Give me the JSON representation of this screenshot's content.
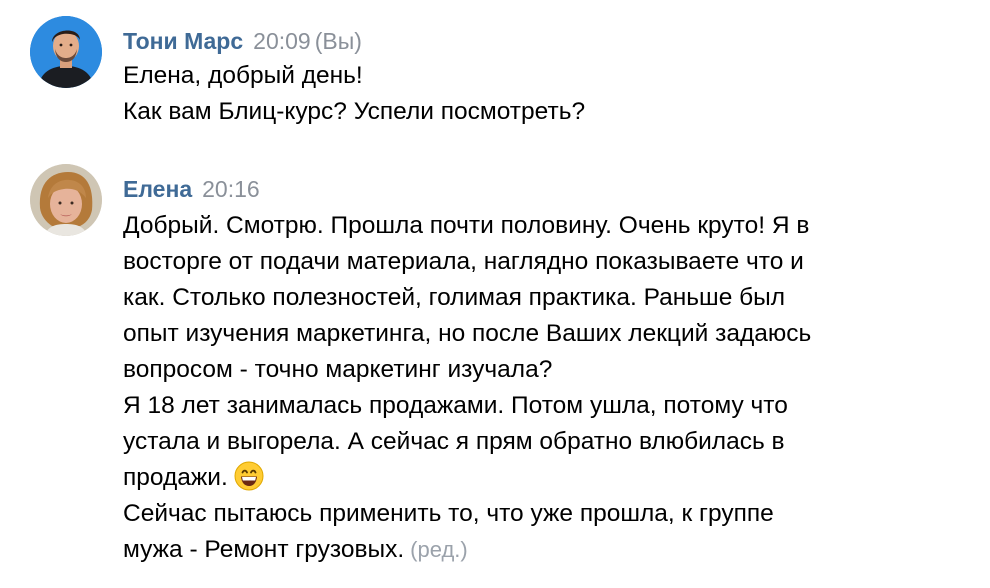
{
  "messages": [
    {
      "author": "Тони Марс",
      "time": "20:09",
      "self_mark": "(Вы)",
      "avatar_icon": "person-photo-man",
      "lines": [
        "Елена, добрый день!",
        "Как вам Блиц-курс? Успели посмотреть?"
      ]
    },
    {
      "author": "Елена",
      "time": "20:16",
      "avatar_icon": "person-photo-woman",
      "lines": [
        "Добрый. Смотрю. Прошла почти половину. Очень круто! Я в",
        "восторге от подачи материала, наглядно показываете что и",
        "как. Столько полезностей, голимая практика. Раньше был",
        "опыт изучения маркетинга, но после Ваших лекций задаюсь",
        "вопросом - точно маркетинг изучала?",
        "Я 18 лет занималась продажами. Потом ушла, потому что",
        "устала и выгорела. А сейчас я прям обратно влюбилась в",
        "продажи.",
        "Сейчас пытаюсь применить то, что уже прошла, к группе",
        "мужа - Ремонт грузовых."
      ],
      "emoji": "grinning-face-emoji",
      "edited": "(ред.)"
    }
  ],
  "colors": {
    "author": "#3f6a96",
    "meta": "#8a9099",
    "edited": "#9ba2ab",
    "text": "#000000",
    "background": "#ffffff"
  }
}
